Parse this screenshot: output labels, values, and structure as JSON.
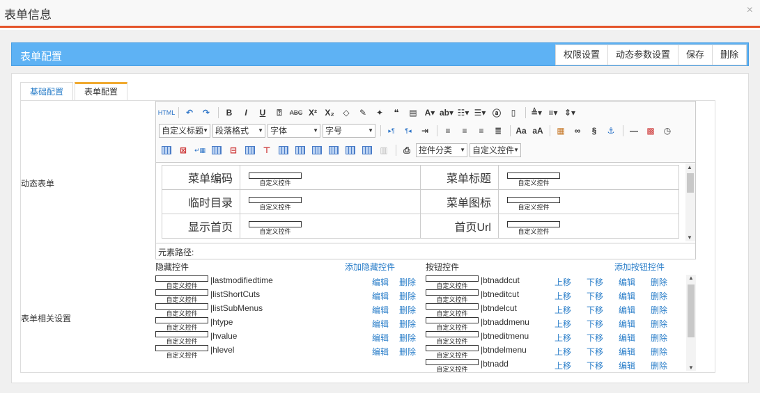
{
  "dialog": {
    "title": "表单信息",
    "close": "×"
  },
  "bar": {
    "title": "表单配置",
    "buttons": [
      "权限设置",
      "动态参数设置",
      "保存",
      "删除"
    ]
  },
  "tabs": [
    "基础配置",
    "表单配置"
  ],
  "labels": {
    "dynamic_form": "动态表单",
    "form_settings": "表单相关设置"
  },
  "toolbar": {
    "html_label": "HTML",
    "selects_row2": [
      "自定义标题",
      "段落格式",
      "字体",
      "字号"
    ],
    "selects_row3": [
      "控件分类",
      "自定义控件"
    ]
  },
  "form_table": [
    [
      {
        "label": "菜单编码",
        "ctl": "自定义控件"
      },
      {
        "label": "菜单标题",
        "ctl": "自定义控件"
      }
    ],
    [
      {
        "label": "临时目录",
        "ctl": "自定义控件"
      },
      {
        "label": "菜单图标",
        "ctl": "自定义控件"
      }
    ],
    [
      {
        "label": "显示首页",
        "ctl": "自定义控件"
      },
      {
        "label": "首页Url",
        "ctl": "自定义控件"
      }
    ]
  ],
  "element_path": "元素路径:",
  "hidden": {
    "title": "隐藏控件",
    "add": "添加隐藏控件",
    "ctl": "自定义控件",
    "edit": "编辑",
    "delete": "删除",
    "items": [
      "|lastmodifiedtime",
      "|listShortCuts",
      "|listSubMenus",
      "|htype",
      "|hvalue",
      "|hlevel"
    ]
  },
  "buttons": {
    "title": "按钮控件",
    "add": "添加按钮控件",
    "ctl": "自定义控件",
    "up": "上移",
    "down": "下移",
    "edit": "编辑",
    "delete": "删除",
    "items": [
      "|btnaddcut",
      "|btneditcut",
      "|btndelcut",
      "|btnaddmenu",
      "|btneditmenu",
      "|btndelmenu",
      "|btnadd"
    ]
  }
}
